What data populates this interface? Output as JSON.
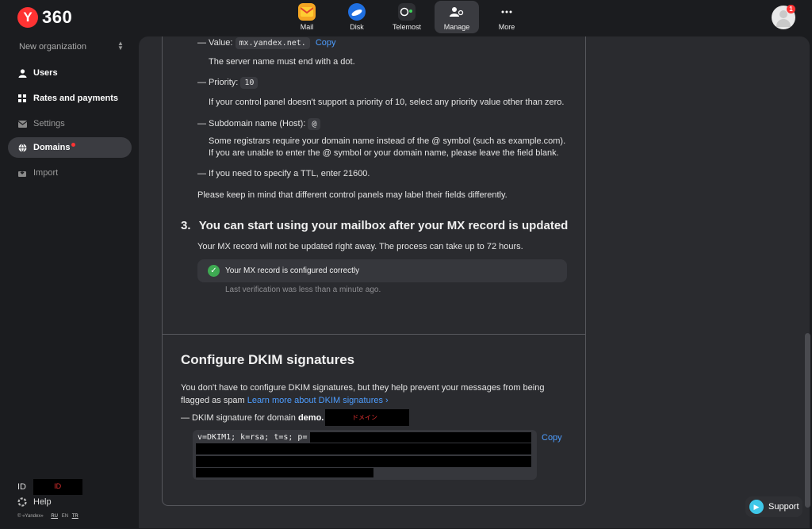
{
  "header": {
    "logo_letter": "Y",
    "logo_text": "360",
    "apps": [
      {
        "label": "Mail",
        "icon": "mail-icon",
        "color": "#f5a623"
      },
      {
        "label": "Disk",
        "icon": "disk-icon",
        "color": "#1f6fe0"
      },
      {
        "label": "Telemost",
        "icon": "telemost-icon",
        "color": "#3a3b40"
      },
      {
        "label": "Manage",
        "icon": "manage-icon",
        "color": "#3a3b40"
      },
      {
        "label": "More",
        "icon": "more-icon",
        "color": "transparent"
      }
    ],
    "notification_count": "1"
  },
  "sidebar": {
    "org_name": "New organization",
    "items": [
      {
        "label": "Users",
        "icon": "user-icon"
      },
      {
        "label": "Rates and payments",
        "icon": "grid-icon"
      },
      {
        "label": "Settings",
        "icon": "settings-icon"
      },
      {
        "label": "Domains",
        "icon": "globe-icon"
      },
      {
        "label": "Import",
        "icon": "import-icon"
      }
    ],
    "id_label": "ID",
    "id_value": "ID",
    "help": "Help",
    "copyright": "© «Yandex»",
    "langs": [
      "RU",
      "EN",
      "TR"
    ]
  },
  "mx": {
    "value_label": "— Value:",
    "value": "mx.yandex.net.",
    "copy": "Copy",
    "value_note": "The server name must end with a dot.",
    "priority_label": "— Priority:",
    "priority": "10",
    "priority_note": "If your control panel doesn't support a priority of 10, select any priority value other than zero.",
    "host_label": "— Subdomain name (Host):",
    "host": "@",
    "host_note1": "Some registrars require your domain name instead of the @ symbol (such as example.com).",
    "host_note2": "If you are unable to enter the @ symbol or your domain name, please leave the field blank.",
    "ttl": "— If you need to specify a TTL, enter 21600.",
    "panels_note": "Please keep in mind that different control panels may label their fields differently.",
    "step_num": "3.",
    "step_title": "You can start using your mailbox after your MX record is updated",
    "step_desc": "Your MX record will not be updated right away. The process can take up to 72 hours.",
    "status": "Your MX record is configured correctly",
    "last_check": "Last verification was less than a minute ago."
  },
  "dkim": {
    "title": "Configure DKIM signatures",
    "desc1": "You don't have to configure DKIM signatures, but they help prevent your messages from being",
    "desc2": "flagged as spam",
    "learn_more": "Learn more about DKIM signatures",
    "domain_label": "— DKIM signature for domain",
    "domain_prefix": "demo.",
    "domain_redacted": "ドメイン",
    "code_prefix": "v=DKIM1; k=rsa; t=s; p=",
    "copy": "Copy"
  },
  "support": {
    "label": "Support"
  }
}
